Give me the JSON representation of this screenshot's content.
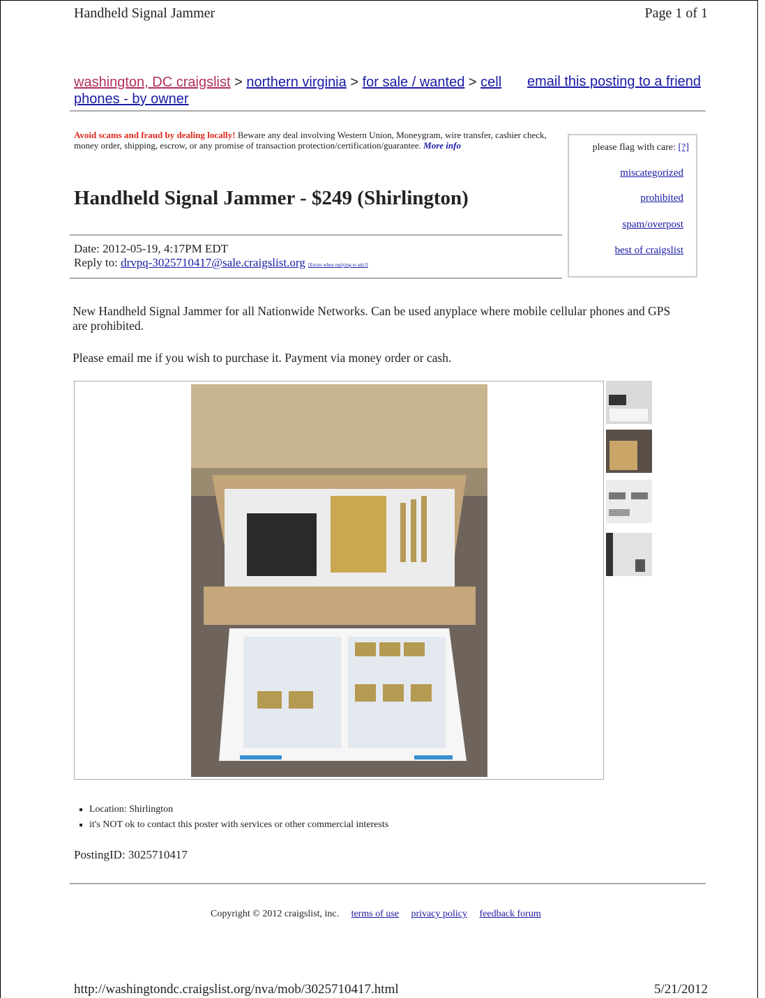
{
  "print_header": {
    "title": "Handheld Signal Jammer",
    "page": "Page 1 of 1"
  },
  "breadcrumbs": {
    "home": "washington, DC craigslist",
    "region": "northern virginia",
    "category": "for sale / wanted",
    "subcategory": "cell phones - by owner",
    "separator": ">"
  },
  "email_friend": "email this posting to a friend",
  "warning": {
    "bold": "Avoid scams and fraud by dealing locally!",
    "text": " Beware any deal involving Western Union, Moneygram, wire transfer, cashier check, money order, shipping, escrow, or any promise of transaction protection/certification/guarantee. ",
    "more_info": "More info"
  },
  "flag_box": {
    "label": "please flag with care:",
    "help": "[?]",
    "links": [
      "miscategorized",
      "prohibited",
      "spam/overpost",
      "best of craigslist"
    ]
  },
  "posting_title": "Handheld Signal Jammer - $249 (Shirlington)",
  "date": "Date: 2012-05-19, 4:17PM EDT",
  "reply_label": "Reply to: ",
  "reply_email": "drvpq-3025710417@sale.craigslist.org",
  "reply_note": "[Errors when replying to ads?]",
  "description": [
    "New Handheld Signal Jammer for all Nationwide Networks. Can be used anyplace where mobile cellular phones and GPS are prohibited.",
    "Please email me if you wish to purchase it. Payment via money order or cash."
  ],
  "attributes": [
    "Location: Shirlington",
    "it's NOT ok to contact this poster with services or other commercial interests"
  ],
  "posting_id": "PostingID: 3025710417",
  "footer": {
    "copyright": "Copyright © 2012 craigslist, inc.",
    "links": [
      "terms of use",
      "privacy policy",
      "feedback forum"
    ]
  },
  "print_footer": {
    "url": "http://washingtondc.craigslist.org/nva/mob/3025710417.html",
    "date": "5/21/2012"
  }
}
